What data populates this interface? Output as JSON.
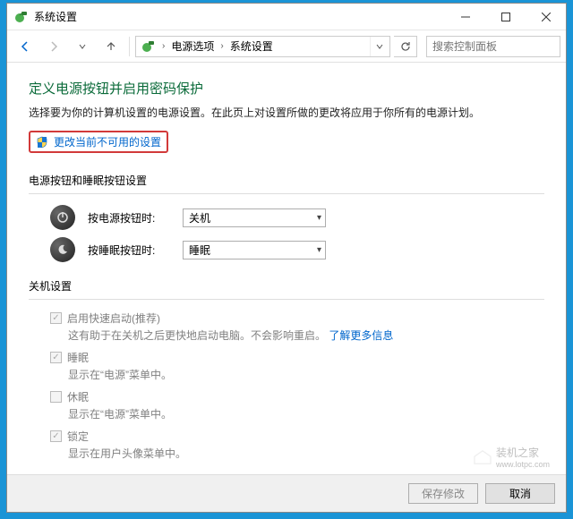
{
  "titlebar": {
    "title": "系统设置"
  },
  "breadcrumb": {
    "item1": "电源选项",
    "item2": "系统设置"
  },
  "search": {
    "placeholder": "搜索控制面板"
  },
  "page": {
    "heading": "定义电源按钮并启用密码保护",
    "subtitle": "选择要为你的计算机设置的电源设置。在此页上对设置所做的更改将应用于你所有的电源计划。",
    "change_link": "更改当前不可用的设置"
  },
  "section_buttons": {
    "title": "电源按钮和睡眠按钮设置",
    "rows": [
      {
        "label": "按电源按钮时:",
        "value": "关机"
      },
      {
        "label": "按睡眠按钮时:",
        "value": "睡眠"
      }
    ]
  },
  "section_shutdown": {
    "title": "关机设置",
    "items": [
      {
        "label": "启用快速启动(推荐)",
        "desc_prefix": "这有助于在关机之后更快地启动电脑。不会影响重启。",
        "link": "了解更多信息",
        "checked": true
      },
      {
        "label": "睡眠",
        "desc": "显示在“电源”菜单中。",
        "checked": true
      },
      {
        "label": "休眠",
        "desc": "显示在“电源”菜单中。",
        "checked": false
      },
      {
        "label": "锁定",
        "desc": "显示在用户头像菜单中。",
        "checked": true
      }
    ]
  },
  "footer": {
    "save": "保存修改",
    "cancel": "取消"
  },
  "watermark": {
    "text": "装机之家",
    "url": "www.lotpc.com"
  }
}
